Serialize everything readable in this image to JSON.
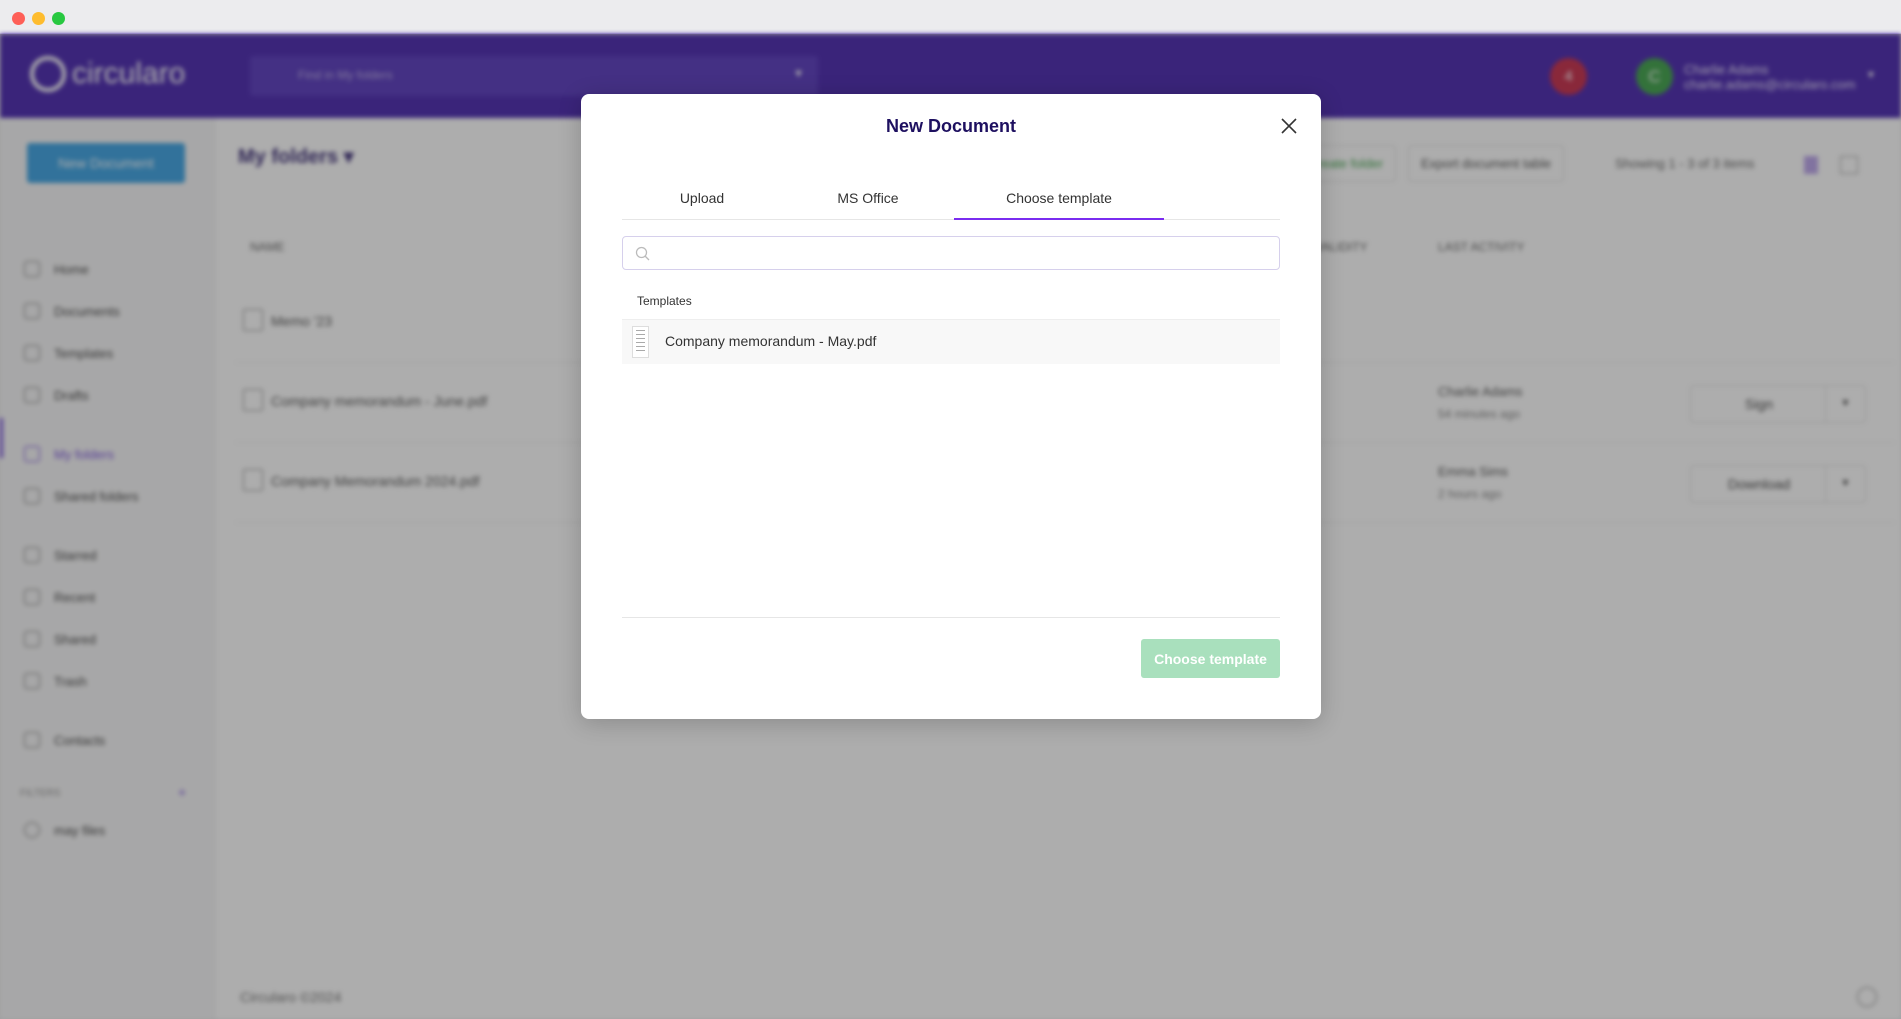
{
  "window": {
    "controls": [
      "close",
      "minimize",
      "maximize"
    ]
  },
  "header": {
    "brand": "circularo",
    "search_placeholder": "Find in My folders",
    "notifications": "4",
    "user_initial": "C",
    "user_name": "Charlie Adams",
    "user_email": "charlie.adams@circularo.com"
  },
  "sidebar": {
    "new_document": "New Document",
    "items": [
      {
        "label": "Home",
        "icon": "home-icon"
      },
      {
        "label": "Documents",
        "icon": "document-icon"
      },
      {
        "label": "Templates",
        "icon": "template-icon"
      },
      {
        "label": "Drafts",
        "icon": "pencil-icon"
      },
      {
        "label": "My folders",
        "icon": "folder-icon",
        "active": true
      },
      {
        "label": "Shared folders",
        "icon": "shared-folder-icon"
      },
      {
        "label": "Starred",
        "icon": "star-icon"
      },
      {
        "label": "Recent",
        "icon": "clock-icon"
      },
      {
        "label": "Shared",
        "icon": "share-icon"
      },
      {
        "label": "Trash",
        "icon": "trash-icon"
      },
      {
        "label": "Contacts",
        "icon": "contacts-icon"
      }
    ],
    "filters_label": "FILTERS",
    "filters": [
      {
        "label": "may files"
      }
    ]
  },
  "main": {
    "title": "My folders",
    "create_folder": "Create folder",
    "export": "Export document table",
    "showing": "Showing 1 - 3 of 3 items",
    "columns": [
      "NAME",
      "VALIDITY",
      "LAST ACTIVITY"
    ],
    "rows": [
      {
        "name": "Memo '23"
      },
      {
        "name": "Company memorandum - June.pdf",
        "user": "Charlie Adams",
        "time": "54 minutes ago",
        "action": "Sign"
      },
      {
        "name": "Company Memorandum 2024.pdf",
        "user": "Emma Sims",
        "time": "2 hours ago",
        "action": "Download"
      }
    ],
    "footer": "Circularo ©2024"
  },
  "modal": {
    "title": "New Document",
    "tabs": [
      "Upload",
      "MS Office",
      "Choose template"
    ],
    "active_tab": "Choose template",
    "search_value": "",
    "section_label": "Templates",
    "templates": [
      {
        "name": "Company memorandum - May.pdf"
      }
    ],
    "confirm": "Choose template",
    "confirm_enabled": false
  },
  "colors": {
    "header": "#3a14a8",
    "accent": "#7a2cf0",
    "confirm": "#a9e0bd",
    "title": "#1e1060"
  }
}
